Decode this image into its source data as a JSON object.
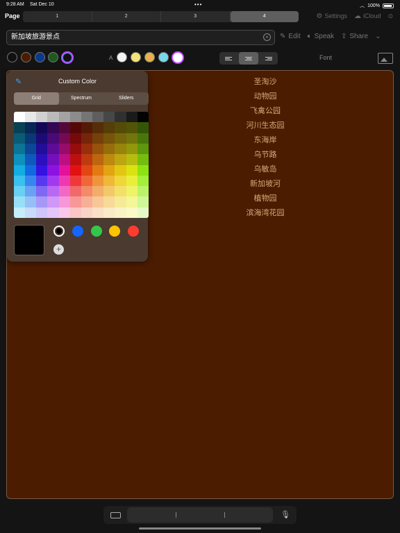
{
  "status_bar": {
    "time": "9:28 AM",
    "date": "Sat Dec 10",
    "wifi_icon": "wifi-icon",
    "battery": "100%"
  },
  "page_bar": {
    "label": "Page",
    "tabs": [
      "1",
      "2",
      "3",
      "4"
    ],
    "active_tab": "4",
    "settings_label": "Settings",
    "icloud_label": "iCloud"
  },
  "title_field": {
    "value": "新加坡旅游景点"
  },
  "actions": {
    "edit": "Edit",
    "speak": "Speak",
    "share": "Share"
  },
  "style_row": {
    "font_size_label": "A",
    "font_button": "Font",
    "background_swatches": [
      "#111111",
      "#4b1c00",
      "#0a3a8a",
      "#1e5a1e",
      "rainbow"
    ],
    "text_swatches": [
      "#f4f4f4",
      "#f4e27a",
      "#e4b24a",
      "#7ad8e8",
      "#ffffff"
    ]
  },
  "color_picker": {
    "title": "Custom Color",
    "tabs": [
      "Grid",
      "Spectrum",
      "Sliders"
    ],
    "active_tab": "Grid",
    "selected_color": "#000000",
    "preset_colors": [
      "#000000",
      "#1565ff",
      "#33c84b",
      "#ffc400",
      "#ff3b30"
    ]
  },
  "content": {
    "background": "#4b1c00",
    "items": [
      "圣淘沙",
      "动物园",
      "飞禽公园",
      "河川生态园",
      "东海岸",
      "乌节路",
      "乌敏岛",
      "新加坡河",
      "植物园",
      "滨海湾花园"
    ]
  }
}
